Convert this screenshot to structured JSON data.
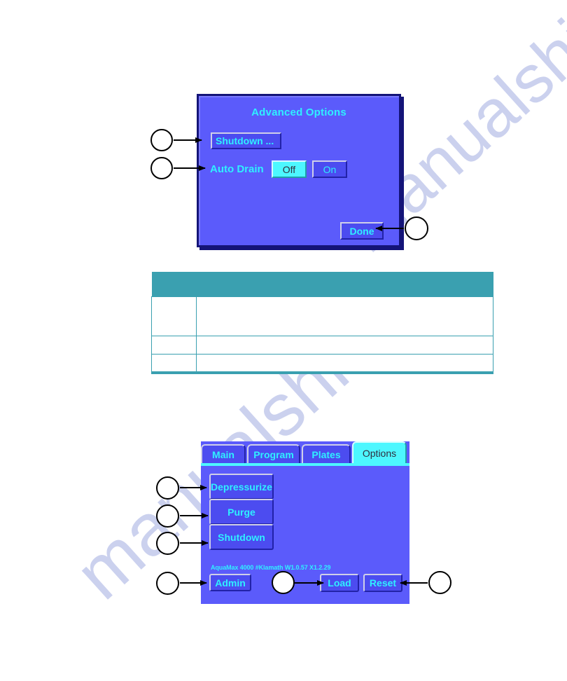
{
  "watermark": {
    "text_right": "manualshive.com",
    "text_left": "manualshive",
    "color": "#c9cfee"
  },
  "colors": {
    "screen_background": "#5b5bfb",
    "button_face": "#4c4cf0",
    "accent_cyan": "#2ff0ff",
    "selected_cyan": "#4df7ff",
    "dialog_border": "#141478",
    "table_teal": "#3aa0b0"
  },
  "advanced_options_dialog": {
    "title": "Advanced Options",
    "shutdown_button": "Shutdown ...",
    "auto_drain_label": "Auto Drain",
    "auto_drain_off": "Off",
    "auto_drain_on": "On",
    "auto_drain_selected": "Off",
    "done_button": "Done"
  },
  "options_screen": {
    "tabs": [
      {
        "label": "Main",
        "active": false
      },
      {
        "label": "Program",
        "active": false
      },
      {
        "label": "Plates",
        "active": false
      },
      {
        "label": "Options",
        "active": true
      }
    ],
    "buttons": {
      "depressurize": "Depressurize",
      "purge": "Purge",
      "shutdown": "Shutdown",
      "admin": "Admin",
      "load": "Load",
      "reset": "Reset"
    },
    "version_text": "AquaMax 4000 #Klamath W1.0.57 X1.2.29"
  },
  "spec_table": {
    "header_cells": [
      "",
      ""
    ],
    "rows": [
      {
        "num": "",
        "text": ""
      },
      {
        "num": "",
        "text": ""
      },
      {
        "num": "",
        "text": ""
      }
    ]
  },
  "callouts": {
    "dialog": [
      {
        "name": "callout-shutdown",
        "label": ""
      },
      {
        "name": "callout-auto-drain",
        "label": ""
      },
      {
        "name": "callout-done",
        "label": ""
      }
    ],
    "options": [
      {
        "name": "callout-depressurize",
        "label": ""
      },
      {
        "name": "callout-purge",
        "label": ""
      },
      {
        "name": "callout-shutdown-2",
        "label": ""
      },
      {
        "name": "callout-admin",
        "label": ""
      },
      {
        "name": "callout-load",
        "label": ""
      },
      {
        "name": "callout-reset",
        "label": ""
      }
    ]
  }
}
